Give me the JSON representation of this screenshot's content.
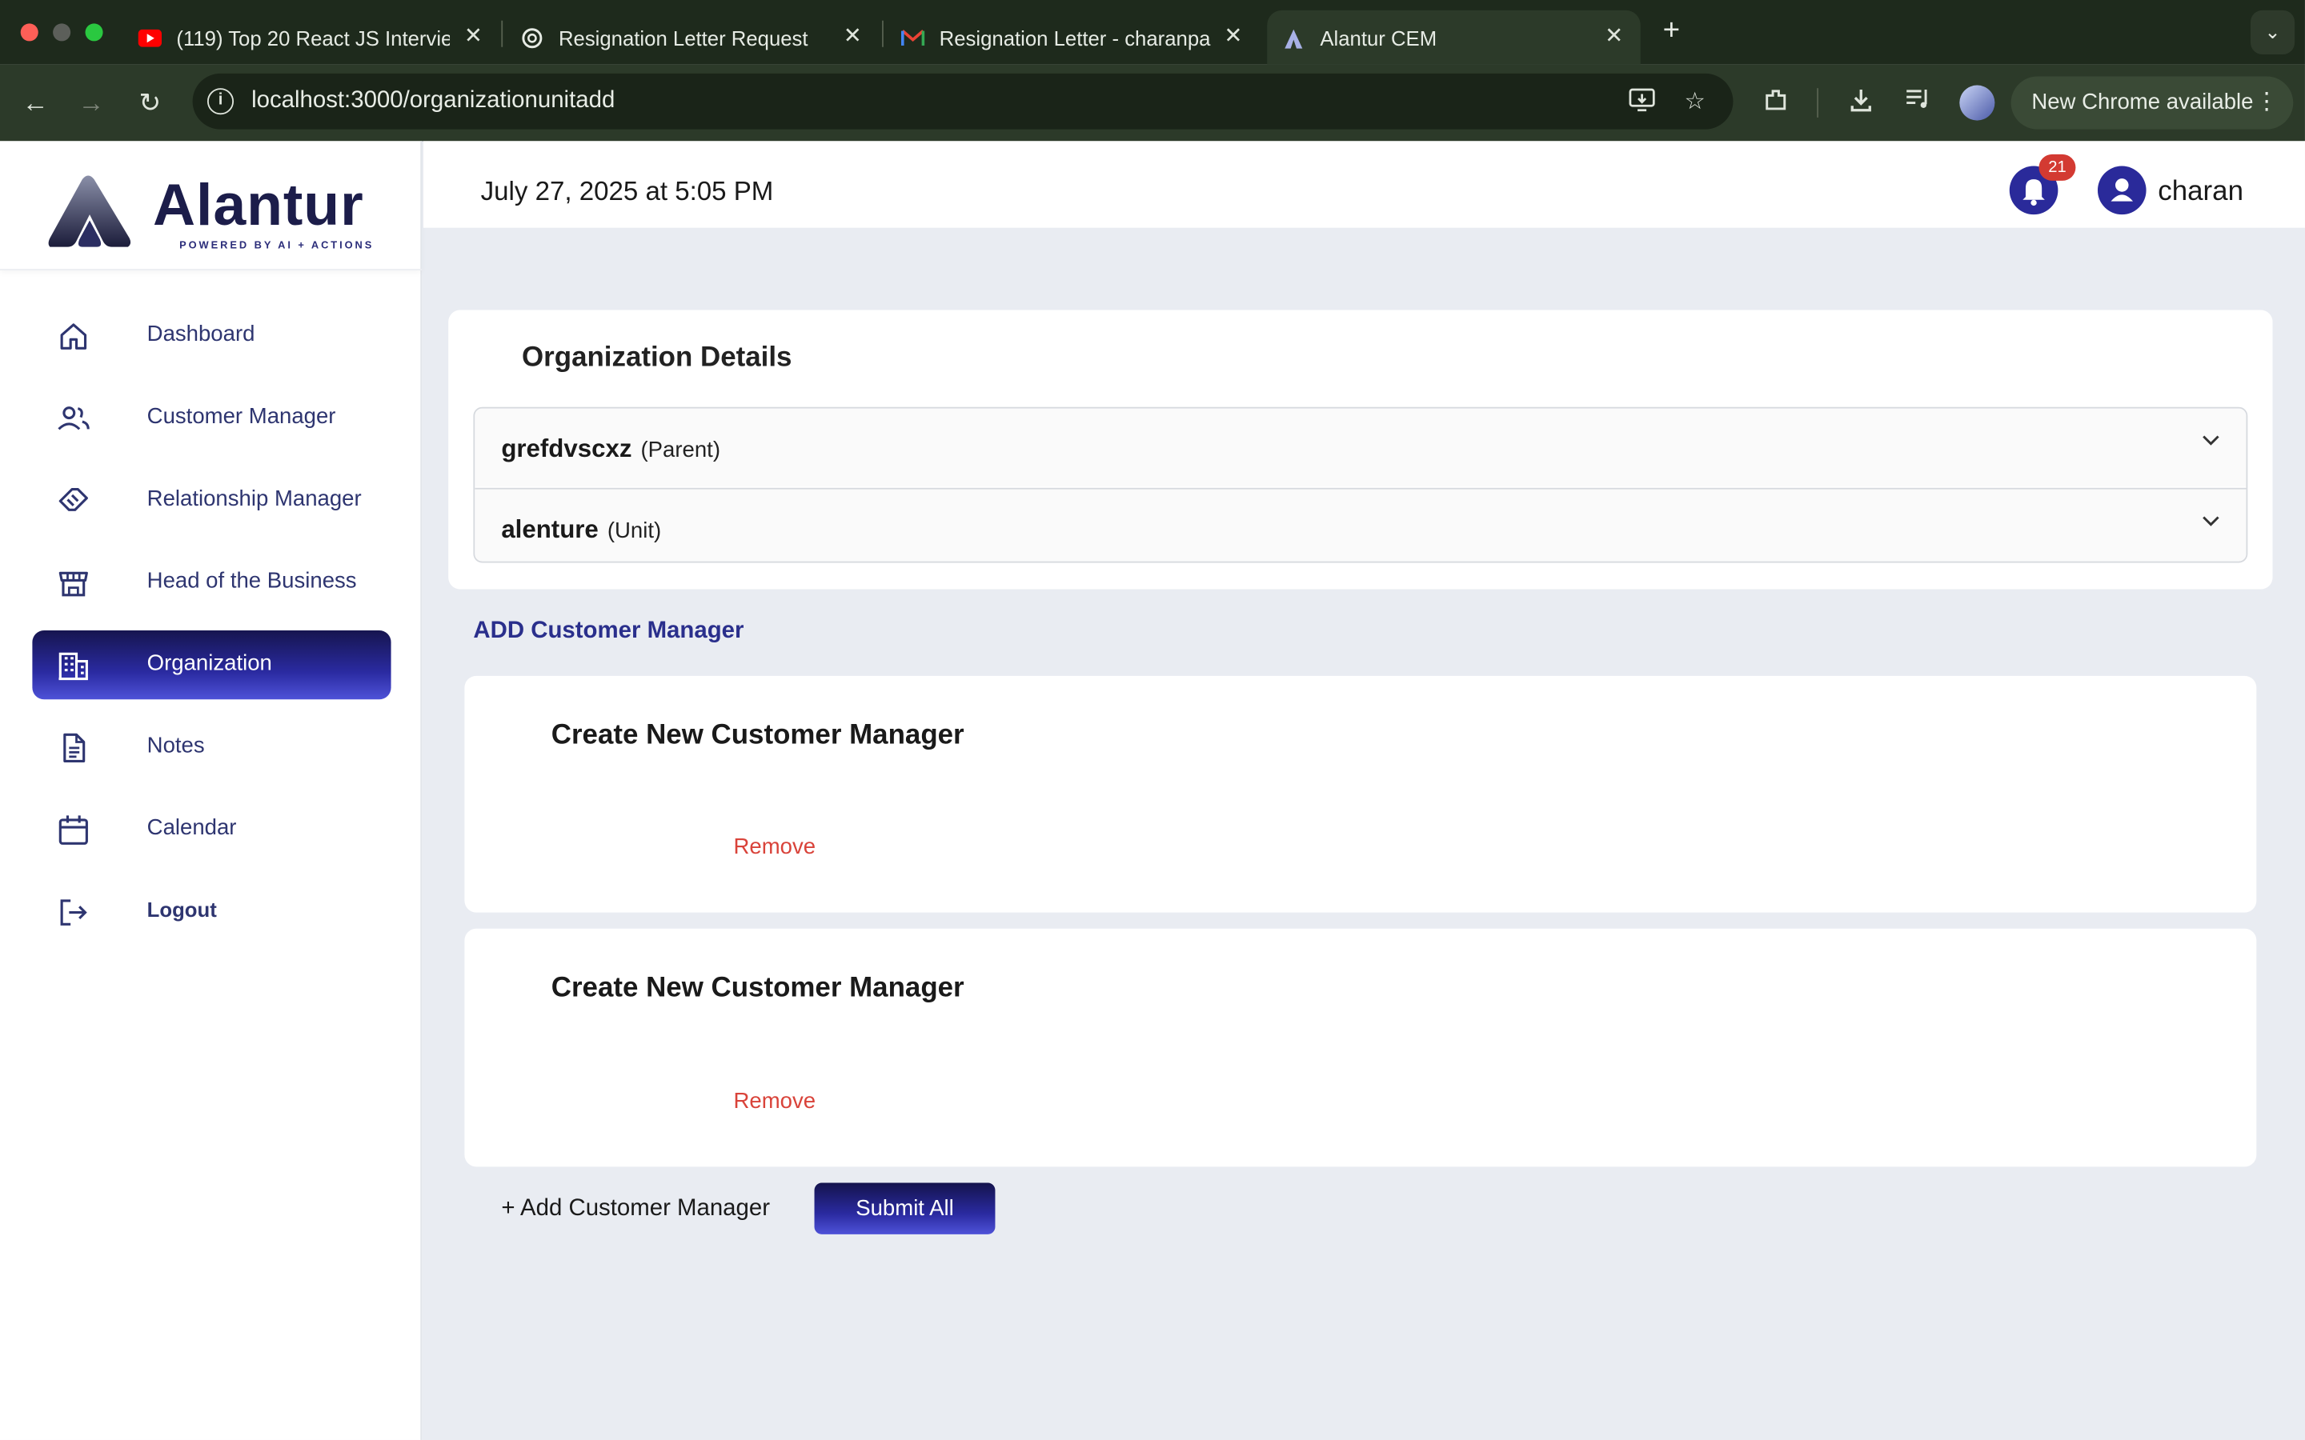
{
  "browser": {
    "tabs": [
      {
        "title": "(119) Top 20 React JS Intervie",
        "icon": "youtube-icon"
      },
      {
        "title": "Resignation Letter Request",
        "icon": "chatgpt-icon"
      },
      {
        "title": "Resignation Letter - charanpa",
        "icon": "gmail-icon"
      },
      {
        "title": "Alantur CEM",
        "icon": "alantur-icon",
        "active": true
      }
    ],
    "url": "localhost:3000/organizationunitadd",
    "new_chrome_label": "New Chrome available"
  },
  "app": {
    "logo_text": "Alantur",
    "logo_tagline": "POWERED BY AI + ACTIONS",
    "nav": [
      {
        "label": "Dashboard",
        "icon": "home-icon"
      },
      {
        "label": "Customer Manager",
        "icon": "users-icon"
      },
      {
        "label": "Relationship Manager",
        "icon": "handshake-icon"
      },
      {
        "label": "Head of the Business",
        "icon": "store-icon"
      },
      {
        "label": "Organization",
        "icon": "building-icon",
        "active": true
      },
      {
        "label": "Notes",
        "icon": "document-icon"
      },
      {
        "label": "Calendar",
        "icon": "calendar-icon"
      },
      {
        "label": "Logout",
        "icon": "logout-icon"
      }
    ],
    "header": {
      "datetime": "July 27, 2025 at 5:05 PM",
      "notification_count": "21",
      "username": "charan"
    },
    "org_details": {
      "title": "Organization Details",
      "items": [
        {
          "name": "grefdvscxz",
          "type": "(Parent)"
        },
        {
          "name": "alenture",
          "type": "(Unit)"
        }
      ]
    },
    "add_cm_link": "ADD Customer Manager",
    "cm_forms": [
      {
        "title": "Create New Customer Manager",
        "remove_label": "Remove"
      },
      {
        "title": "Create New Customer Manager",
        "remove_label": "Remove"
      }
    ],
    "add_more_label": "+ Add Customer Manager",
    "submit_label": "Submit All"
  },
  "colors": {
    "accent": "#2a2aa0",
    "remove": "#d9433a",
    "badge": "#d33a32",
    "page_bg": "#e9ecf2"
  }
}
